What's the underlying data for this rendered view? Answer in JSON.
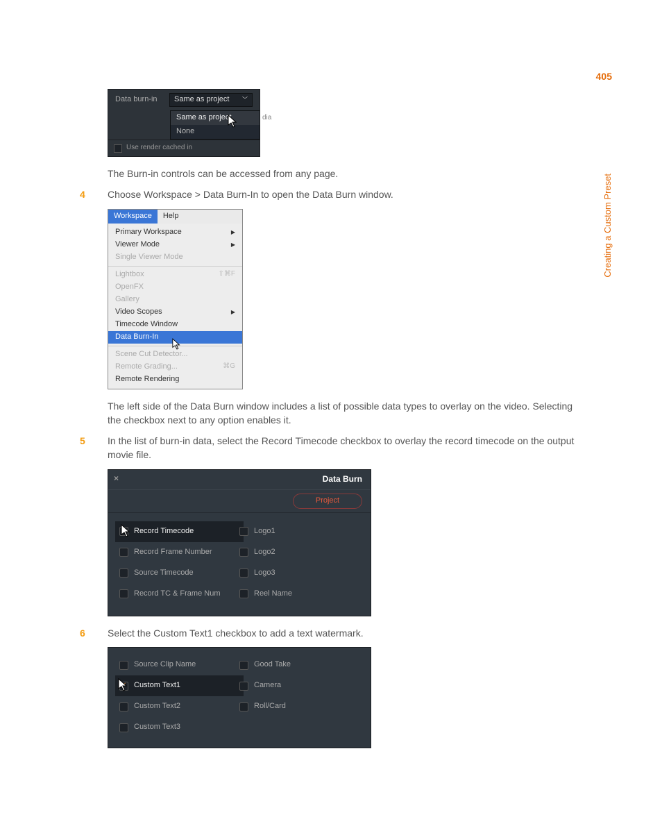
{
  "page_number": "405",
  "sidebar_label": "Creating a Custom Preset",
  "fig1": {
    "label": "Data burn-in",
    "selected": "Same as project",
    "options": [
      "Same as project",
      "None"
    ],
    "partial_right": "dia",
    "bottom": "Use render cached in"
  },
  "text1": "The Burn-in controls can be accessed from any page.",
  "step4": {
    "num": "4",
    "text": "Choose Workspace > Data Burn-In to open the Data Burn window."
  },
  "fig2": {
    "menus": [
      "Workspace",
      "Help"
    ],
    "items": [
      {
        "label": "Primary Workspace",
        "submenu": true
      },
      {
        "label": "Viewer Mode",
        "submenu": true
      },
      {
        "label": "Single Viewer Mode",
        "disabled": true
      },
      {
        "sep": true
      },
      {
        "label": "Lightbox",
        "shortcut": "⇧⌘F",
        "disabled": true
      },
      {
        "label": "OpenFX",
        "disabled": true
      },
      {
        "label": "Gallery",
        "disabled": true
      },
      {
        "label": "Video Scopes",
        "submenu": true
      },
      {
        "label": "Timecode Window"
      },
      {
        "label": "Data Burn-In",
        "selected": true
      },
      {
        "sep": true
      },
      {
        "label": "Scene Cut Detector...",
        "disabled": true
      },
      {
        "label": "Remote Grading...",
        "shortcut": "⌘G",
        "disabled": true
      },
      {
        "label": "Remote Rendering"
      }
    ]
  },
  "text2": "The left side of the Data Burn window includes a list of possible data types to overlay on the video. Selecting the checkbox next to any option enables it.",
  "step5": {
    "num": "5",
    "text": "In the list of burn-in data, select the Record Timecode checkbox to overlay the record timecode on the output movie file."
  },
  "fig3": {
    "title": "Data Burn",
    "tab": "Project",
    "left": [
      "Record Timecode",
      "Record Frame Number",
      "Source Timecode",
      "Record TC & Frame Num"
    ],
    "right": [
      "Logo1",
      "Logo2",
      "Logo3",
      "Reel Name"
    ]
  },
  "step6": {
    "num": "6",
    "text": "Select the Custom Text1 checkbox to add a text watermark."
  },
  "fig4": {
    "left": [
      "Source Clip Name",
      "Custom Text1",
      "Custom Text2",
      "Custom Text3"
    ],
    "right": [
      "Good Take",
      "Camera",
      "Roll/Card"
    ]
  }
}
